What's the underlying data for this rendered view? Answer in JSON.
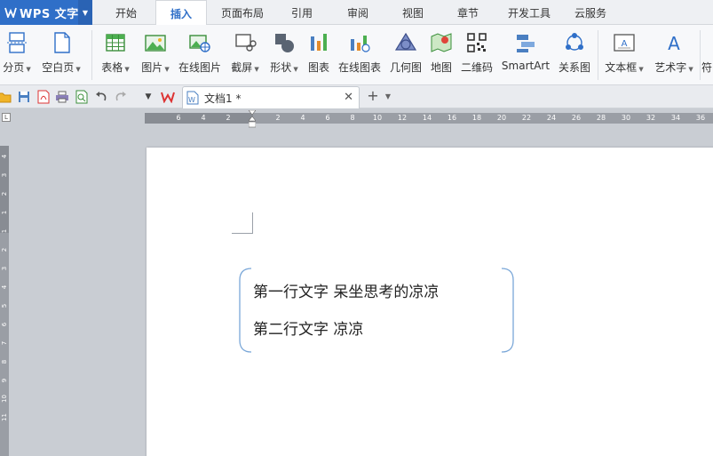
{
  "app": {
    "title": "WPS 文字"
  },
  "menu": {
    "tabs": [
      {
        "label": "开始",
        "active": false
      },
      {
        "label": "插入",
        "active": true
      },
      {
        "label": "页面布局",
        "active": false
      },
      {
        "label": "引用",
        "active": false
      },
      {
        "label": "审阅",
        "active": false
      },
      {
        "label": "视图",
        "active": false
      },
      {
        "label": "章节",
        "active": false
      },
      {
        "label": "开发工具",
        "active": false
      },
      {
        "label": "云服务",
        "active": false
      }
    ]
  },
  "ribbon": {
    "items": [
      {
        "label": "分页",
        "dropdown": true,
        "icon": "page-break-icon"
      },
      {
        "label": "空白页",
        "dropdown": true,
        "icon": "blank-page-icon"
      },
      {
        "label": "表格",
        "dropdown": true,
        "icon": "table-icon"
      },
      {
        "label": "图片",
        "dropdown": true,
        "icon": "picture-icon"
      },
      {
        "label": "在线图片",
        "dropdown": false,
        "icon": "online-picture-icon"
      },
      {
        "label": "截屏",
        "dropdown": true,
        "icon": "screenshot-icon"
      },
      {
        "label": "形状",
        "dropdown": true,
        "icon": "shapes-icon"
      },
      {
        "label": "图表",
        "dropdown": false,
        "icon": "chart-icon"
      },
      {
        "label": "在线图表",
        "dropdown": false,
        "icon": "online-chart-icon"
      },
      {
        "label": "几何图",
        "dropdown": false,
        "icon": "geometry-icon"
      },
      {
        "label": "地图",
        "dropdown": false,
        "icon": "map-icon"
      },
      {
        "label": "二维码",
        "dropdown": false,
        "icon": "qrcode-icon"
      },
      {
        "label": "SmartArt",
        "dropdown": false,
        "icon": "smartart-icon"
      },
      {
        "label": "关系图",
        "dropdown": false,
        "icon": "relation-diagram-icon"
      },
      {
        "label": "文本框",
        "dropdown": true,
        "icon": "textbox-icon"
      },
      {
        "label": "艺术字",
        "dropdown": true,
        "icon": "wordart-icon"
      },
      {
        "label": "符",
        "dropdown": false,
        "icon": "symbol-icon"
      }
    ]
  },
  "document": {
    "tab_name": "文档1 *",
    "lines": [
      "第一行文字 呆坐思考的凉凉",
      "第二行文字 凉凉"
    ]
  },
  "ruler": {
    "h_ticks": [
      "6",
      "4",
      "2",
      "2",
      "4",
      "6",
      "8",
      "10",
      "12",
      "14",
      "16",
      "18",
      "20",
      "22",
      "24",
      "26",
      "28",
      "30",
      "32",
      "34",
      "36"
    ],
    "v_ticks": [
      "4",
      "3",
      "2",
      "1",
      "1",
      "2",
      "3",
      "4",
      "5",
      "6",
      "7",
      "8",
      "9",
      "10",
      "11"
    ]
  },
  "colors": {
    "brand": "#2f6fc8",
    "active_tab_text": "#2f6fc8",
    "textbox_border": "#7aa7d8"
  }
}
